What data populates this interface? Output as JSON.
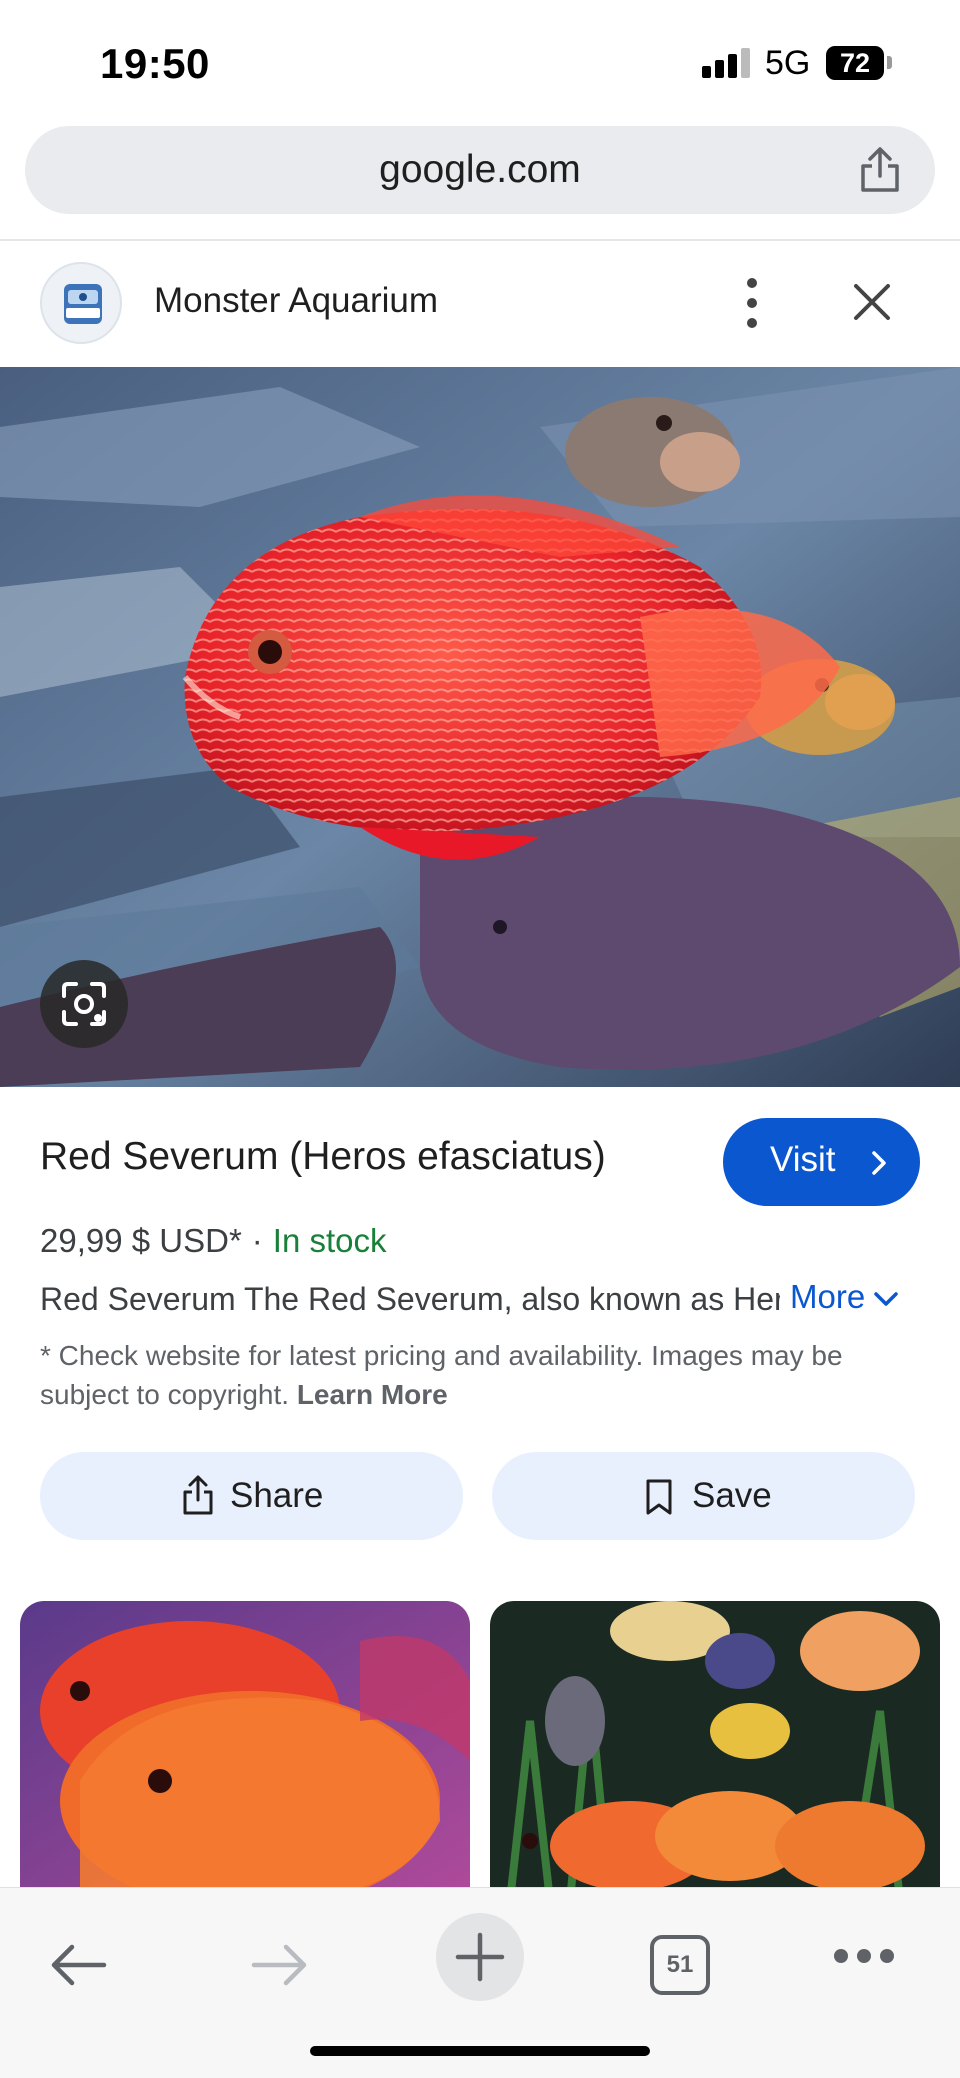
{
  "status_bar": {
    "time": "19:50",
    "network": "5G",
    "battery": "72"
  },
  "browser": {
    "url": "google.com"
  },
  "source": {
    "site_name": "Monster Aquarium"
  },
  "product": {
    "title": "Red Severum (Heros efasciatus)",
    "visit_label": "Visit",
    "price": "29,99 $ USD*",
    "separator": "·",
    "stock": "In stock",
    "description": "Red Severum The Red Severum, also known as Heros efasciatus…",
    "more_label": "More",
    "disclaimer": "* Check website for latest pricing and availability. Images may be subject to copyright.",
    "learn_more": "Learn More"
  },
  "actions": {
    "share_label": "Share",
    "save_label": "Save"
  },
  "toolbar": {
    "tab_count": "51"
  },
  "colors": {
    "accent": "#0b57d0",
    "stock_green": "#188038",
    "action_bg": "#e8f0fe"
  },
  "icons": [
    "share-icon",
    "kebab-menu-icon",
    "close-icon",
    "lens-camera-icon",
    "chevron-right-icon",
    "chevron-down-icon",
    "bookmark-icon",
    "back-arrow-icon",
    "forward-arrow-icon",
    "plus-icon",
    "more-dots-icon"
  ]
}
